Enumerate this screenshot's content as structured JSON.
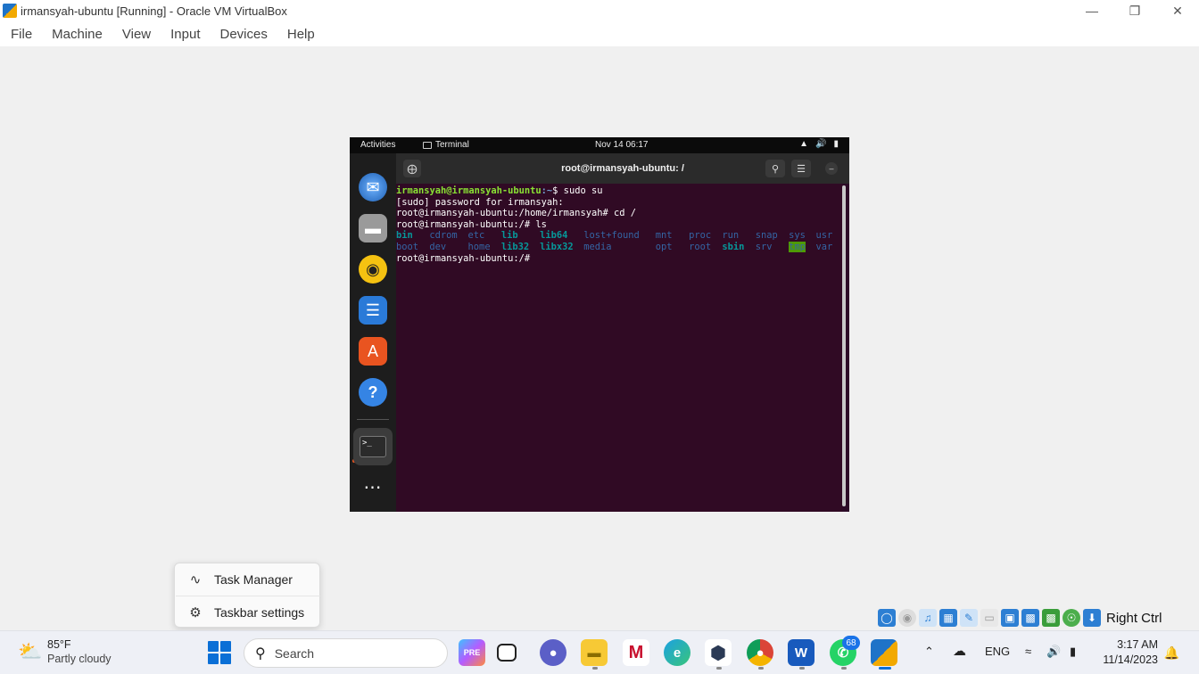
{
  "window": {
    "title": "irmansyah-ubuntu [Running] - Oracle VM VirtualBox",
    "minimize": "—",
    "restore": "❐",
    "close": "✕"
  },
  "menubar": [
    "File",
    "Machine",
    "View",
    "Input",
    "Devices",
    "Help"
  ],
  "gnome": {
    "activities": "Activities",
    "app_name": "Terminal",
    "clock": "Nov 14  06:17"
  },
  "dock": {
    "icons": [
      "thunderbird-icon",
      "files-icon",
      "rhythmbox-icon",
      "libreoffice-writer-icon",
      "app-center-icon",
      "help-icon",
      "terminal-icon",
      "show-apps-icon"
    ]
  },
  "terminal": {
    "title": "root@irmansyah-ubuntu: /",
    "line1_user": "irmansyah@irmansyah-ubuntu",
    "line1_path": ":~",
    "line1_cmd": "$ sudo su",
    "line2": "[sudo] password for irmansyah:",
    "line3": "root@irmansyah-ubuntu:/home/irmansyah# cd /",
    "line4": "root@irmansyah-ubuntu:/# ls",
    "ls_row1": [
      "bin",
      "cdrom",
      "etc",
      "lib",
      "lib64",
      "lost+found",
      "mnt",
      "proc",
      "run",
      "snap",
      "sys",
      "usr"
    ],
    "ls_row2": [
      "boot",
      "dev",
      "home",
      "lib32",
      "libx32",
      "media",
      "opt",
      "root",
      "sbin",
      "srv",
      "tmp",
      "var"
    ],
    "line_last": "root@irmansyah-ubuntu:/#"
  },
  "context_menu": {
    "task_manager": "Task Manager",
    "taskbar_settings": "Taskbar settings"
  },
  "vb_status": {
    "host_key": "Right Ctrl"
  },
  "taskbar": {
    "weather_temp": "85°F",
    "weather_cond": "Partly cloudy",
    "search_placeholder": "Search",
    "whatsapp_badge": "68",
    "lang": "ENG",
    "time": "3:17 AM",
    "date": "11/14/2023"
  }
}
